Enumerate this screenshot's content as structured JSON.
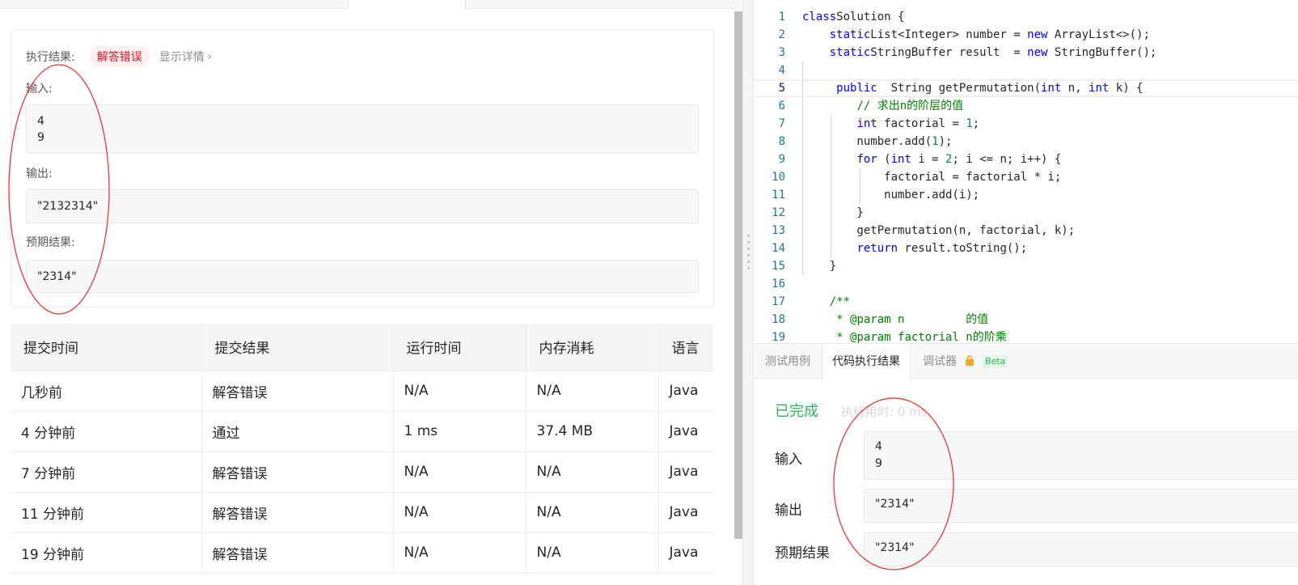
{
  "result_panel": {
    "status_label": "执行结果:",
    "status_value": "解答错误",
    "details_link": "显示详情",
    "input_label": "输入:",
    "input_lines": [
      "4",
      "9"
    ],
    "output_label": "输出:",
    "output_value": "\"2132314\"",
    "expected_label": "预期结果:",
    "expected_value": "\"2314\""
  },
  "history": {
    "columns": [
      "提交时间",
      "提交结果",
      "运行时间",
      "内存消耗",
      "语言"
    ],
    "rows": [
      {
        "time": "几秒前",
        "result": "解答错误",
        "status": "wrong",
        "runtime": "N/A",
        "memory": "N/A",
        "lang": "Java"
      },
      {
        "time": "4 分钟前",
        "result": "通过",
        "status": "pass",
        "runtime": "1 ms",
        "memory": "37.4 MB",
        "lang": "Java"
      },
      {
        "time": "7 分钟前",
        "result": "解答错误",
        "status": "wrong",
        "runtime": "N/A",
        "memory": "N/A",
        "lang": "Java"
      },
      {
        "time": "11 分钟前",
        "result": "解答错误",
        "status": "wrong",
        "runtime": "N/A",
        "memory": "N/A",
        "lang": "Java"
      },
      {
        "time": "19 分钟前",
        "result": "解答错误",
        "status": "wrong",
        "runtime": "N/A",
        "memory": "N/A",
        "lang": "Java"
      }
    ]
  },
  "editor": {
    "current_line": 5,
    "lines": [
      [
        [
          "kw",
          "class"
        ],
        [
          "",
          "Solution {"
        ]
      ],
      [
        [
          "",
          "    "
        ],
        [
          "kw",
          "static"
        ],
        [
          "",
          "List<Integer> number = "
        ],
        [
          "kw",
          "new"
        ],
        [
          "",
          " ArrayList<>();"
        ]
      ],
      [
        [
          "",
          "    "
        ],
        [
          "kw",
          "static"
        ],
        [
          "",
          "StringBuffer result  = "
        ],
        [
          "kw",
          "new"
        ],
        [
          "",
          " StringBuffer();"
        ]
      ],
      [
        [
          "",
          ""
        ]
      ],
      [
        [
          "",
          "     "
        ],
        [
          "kw",
          "public"
        ],
        [
          "",
          "  String getPermutation("
        ],
        [
          "kw",
          "int"
        ],
        [
          "",
          " n, "
        ],
        [
          "kw",
          "int"
        ],
        [
          "",
          " k) {"
        ]
      ],
      [
        [
          "",
          "        "
        ],
        [
          "cm",
          "// 求出n的阶层的值"
        ]
      ],
      [
        [
          "",
          "        "
        ],
        [
          "kw",
          "int"
        ],
        [
          "",
          " factorial = "
        ],
        [
          "num",
          "1"
        ],
        [
          "",
          ";"
        ]
      ],
      [
        [
          "",
          "        number.add("
        ],
        [
          "num",
          "1"
        ],
        [
          "",
          ");"
        ]
      ],
      [
        [
          "",
          "        "
        ],
        [
          "kw",
          "for"
        ],
        [
          "",
          " ("
        ],
        [
          "kw",
          "int"
        ],
        [
          "",
          " i = "
        ],
        [
          "num",
          "2"
        ],
        [
          "",
          "; i <= n; i++) {"
        ]
      ],
      [
        [
          "",
          "            factorial = factorial * i;"
        ]
      ],
      [
        [
          "",
          "            number.add(i);"
        ]
      ],
      [
        [
          "",
          "        }"
        ]
      ],
      [
        [
          "",
          "        getPermutation(n, factorial, k);"
        ]
      ],
      [
        [
          "",
          "        "
        ],
        [
          "kw",
          "return"
        ],
        [
          "",
          " result.toString();"
        ]
      ],
      [
        [
          "",
          "    }"
        ]
      ],
      [
        [
          "",
          ""
        ]
      ],
      [
        [
          "",
          "    "
        ],
        [
          "cm",
          "/**"
        ]
      ],
      [
        [
          "",
          "     "
        ],
        [
          "cm",
          "* @param n         的值"
        ]
      ],
      [
        [
          "",
          "     "
        ],
        [
          "cm",
          "* @param factorial n的阶乘"
        ]
      ]
    ]
  },
  "console": {
    "tabs": [
      "测试用例",
      "代码执行结果",
      "调试器"
    ],
    "active_tab": "代码执行结果",
    "beta_badge": "Beta",
    "status": "已完成",
    "exec_time": "执行用时: 0 ms",
    "input_label": "输入",
    "input_lines": [
      "4",
      "9"
    ],
    "output_label": "输出",
    "output_value": "\"2314\"",
    "expected_label": "预期结果",
    "expected_value": "\"2314\""
  },
  "colors": {
    "wrong": "#ef4743",
    "pass": "#2db55d",
    "annotation": "#e53935"
  }
}
